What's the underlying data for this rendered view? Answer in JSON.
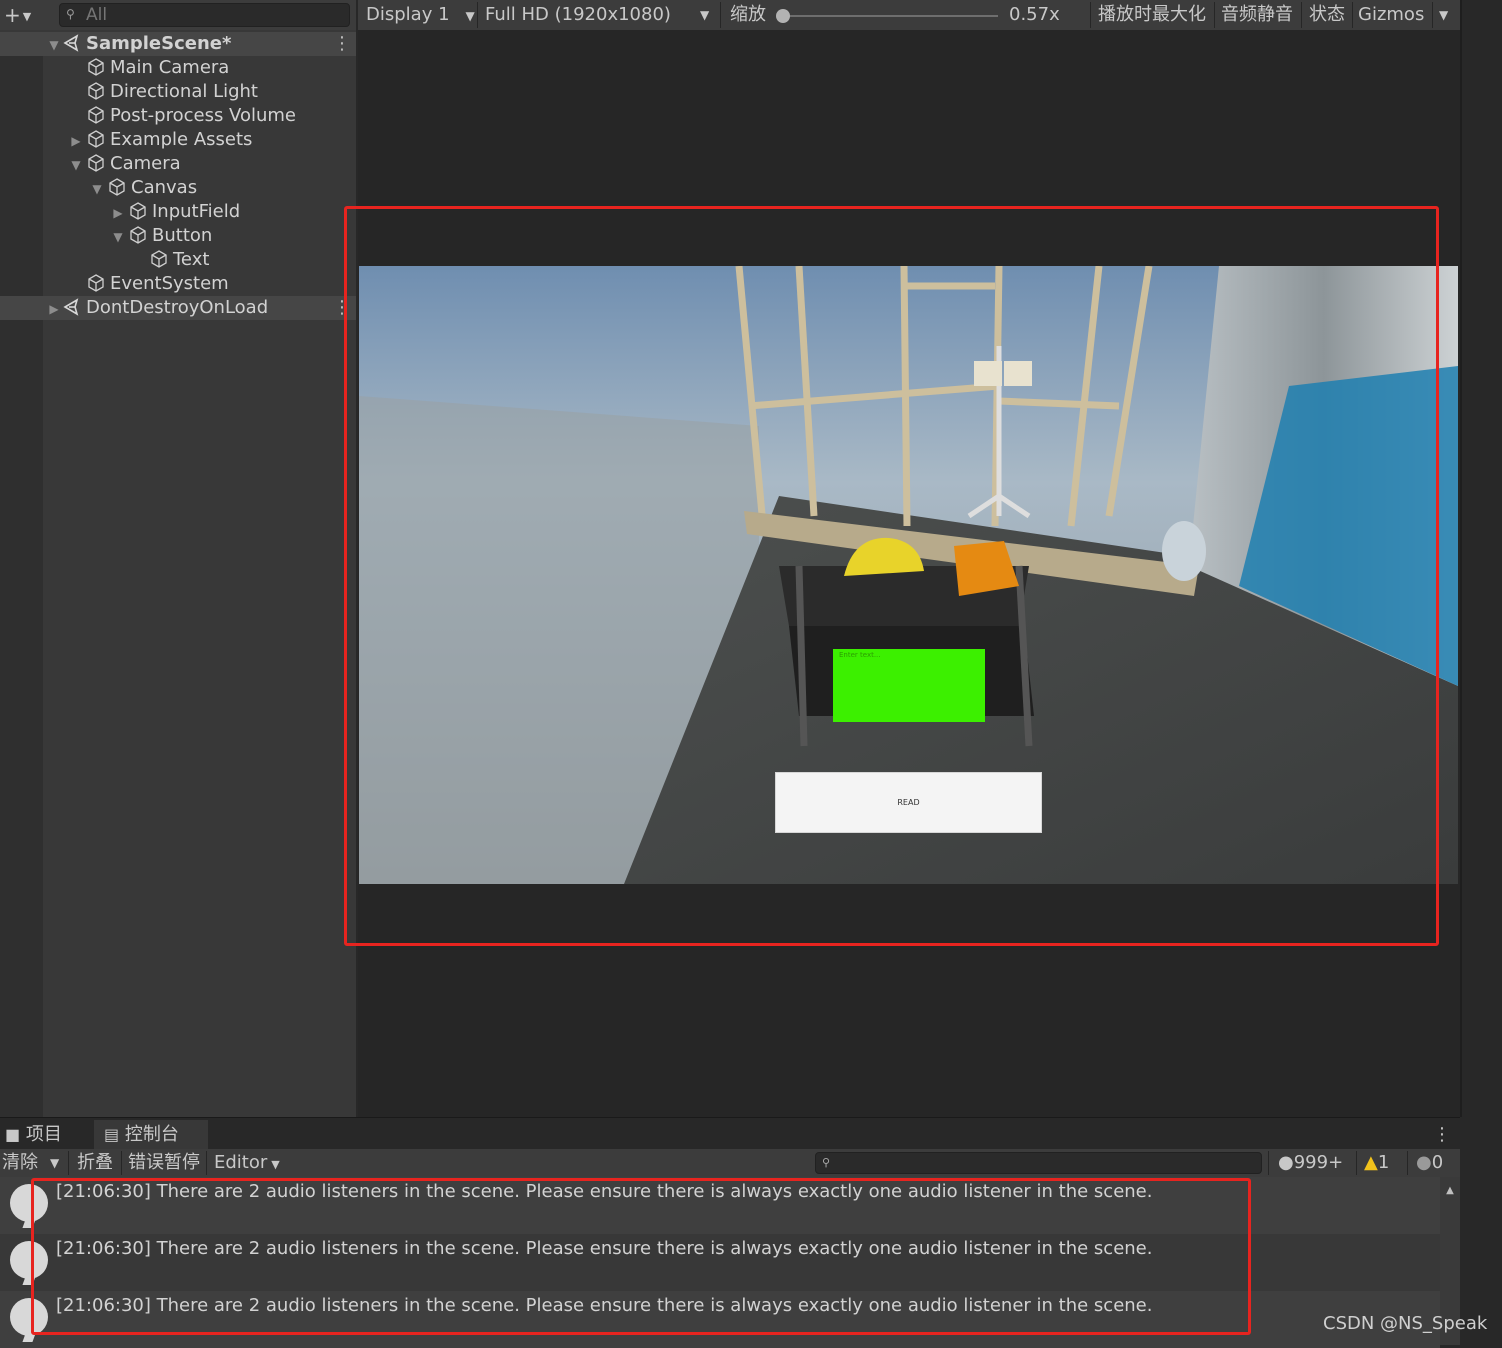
{
  "hierarchy": {
    "add_label": "+",
    "search_placeholder": "All",
    "scene": "SampleScene*",
    "items": [
      "Main Camera",
      "Directional Light",
      "Post-process Volume",
      "Example Assets",
      "Camera",
      "Canvas",
      "InputField",
      "Button",
      "Text",
      "EventSystem"
    ],
    "dont_destroy": "DontDestroyOnLoad"
  },
  "game_toolbar": {
    "display": "Display 1",
    "resolution": "Full HD (1920x1080)",
    "zoom_label": "缩放",
    "zoom_value": "0.57x",
    "maximize": "播放时最大化",
    "mute": "音频静音",
    "stats": "状态",
    "gizmos": "Gizmos"
  },
  "game_ui": {
    "input_placeholder": "Enter text...",
    "read_button": "READ"
  },
  "bottom_tabs": {
    "project": "项目",
    "console": "控制台"
  },
  "console_toolbar": {
    "clear": "清除",
    "collapse": "折叠",
    "error_pause": "错误暂停",
    "editor": "Editor",
    "log_count": "999+",
    "warning_count": "1",
    "error_count": "0"
  },
  "console_logs": [
    "[21:06:30] There are 2 audio listeners in the scene. Please ensure there is always exactly one audio listener in the scene.",
    "[21:06:30] There are 2 audio listeners in the scene. Please ensure there is always exactly one audio listener in the scene.",
    "[21:06:30] There are 2 audio listeners in the scene. Please ensure there is always exactly one audio listener in the scene."
  ],
  "watermark": "CSDN @NS_Speak",
  "colors": {
    "highlight_box": "#e7241f",
    "input_field": "#3cf000",
    "editor_bg": "#383838"
  }
}
